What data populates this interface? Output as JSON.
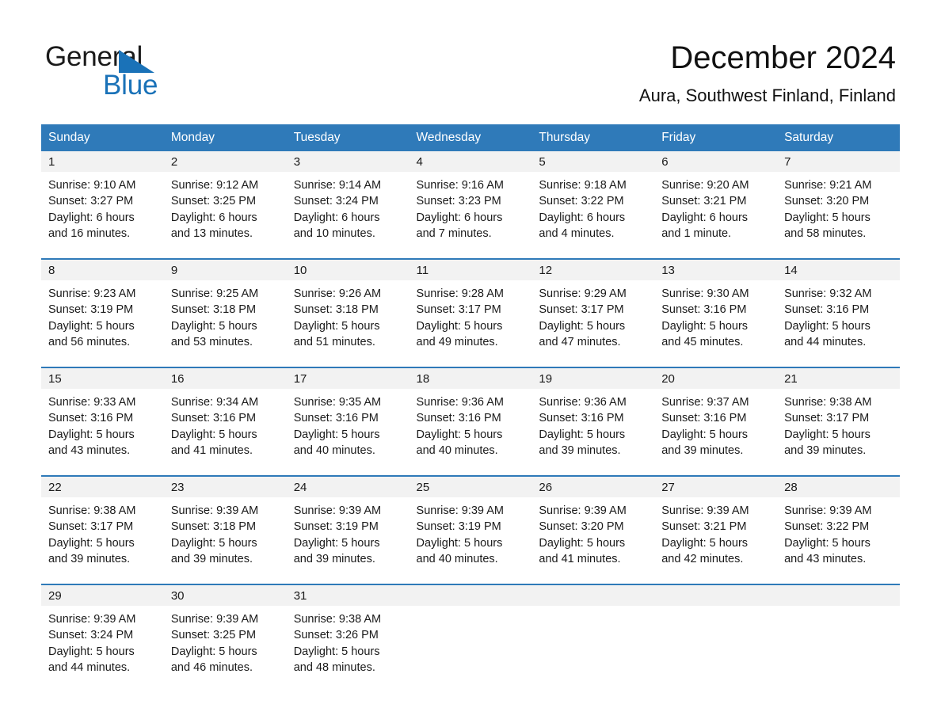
{
  "brand": {
    "name_part1": "General",
    "name_part2": "Blue",
    "triangle_icon": "triangle-icon",
    "accent_color": "#1a72b8"
  },
  "header": {
    "month_title": "December 2024",
    "location": "Aura, Southwest Finland, Finland"
  },
  "theme": {
    "header_row_bg": "#2f7ab9",
    "daynum_band_bg": "#f2f2f2",
    "row_divider": "#2f7ab9",
    "text": "#1a1a1a"
  },
  "weekday_headers": [
    "Sunday",
    "Monday",
    "Tuesday",
    "Wednesday",
    "Thursday",
    "Friday",
    "Saturday"
  ],
  "labels": {
    "sunrise_prefix": "Sunrise:",
    "sunset_prefix": "Sunset:",
    "daylight_prefix": "Daylight:"
  },
  "weeks": [
    {
      "days": [
        {
          "day": "1",
          "sunrise": "Sunrise: 9:10 AM",
          "sunset": "Sunset: 3:27 PM",
          "daylight_line1": "Daylight: 6 hours",
          "daylight_line2": "and 16 minutes."
        },
        {
          "day": "2",
          "sunrise": "Sunrise: 9:12 AM",
          "sunset": "Sunset: 3:25 PM",
          "daylight_line1": "Daylight: 6 hours",
          "daylight_line2": "and 13 minutes."
        },
        {
          "day": "3",
          "sunrise": "Sunrise: 9:14 AM",
          "sunset": "Sunset: 3:24 PM",
          "daylight_line1": "Daylight: 6 hours",
          "daylight_line2": "and 10 minutes."
        },
        {
          "day": "4",
          "sunrise": "Sunrise: 9:16 AM",
          "sunset": "Sunset: 3:23 PM",
          "daylight_line1": "Daylight: 6 hours",
          "daylight_line2": "and 7 minutes."
        },
        {
          "day": "5",
          "sunrise": "Sunrise: 9:18 AM",
          "sunset": "Sunset: 3:22 PM",
          "daylight_line1": "Daylight: 6 hours",
          "daylight_line2": "and 4 minutes."
        },
        {
          "day": "6",
          "sunrise": "Sunrise: 9:20 AM",
          "sunset": "Sunset: 3:21 PM",
          "daylight_line1": "Daylight: 6 hours",
          "daylight_line2": "and 1 minute."
        },
        {
          "day": "7",
          "sunrise": "Sunrise: 9:21 AM",
          "sunset": "Sunset: 3:20 PM",
          "daylight_line1": "Daylight: 5 hours",
          "daylight_line2": "and 58 minutes."
        }
      ]
    },
    {
      "days": [
        {
          "day": "8",
          "sunrise": "Sunrise: 9:23 AM",
          "sunset": "Sunset: 3:19 PM",
          "daylight_line1": "Daylight: 5 hours",
          "daylight_line2": "and 56 minutes."
        },
        {
          "day": "9",
          "sunrise": "Sunrise: 9:25 AM",
          "sunset": "Sunset: 3:18 PM",
          "daylight_line1": "Daylight: 5 hours",
          "daylight_line2": "and 53 minutes."
        },
        {
          "day": "10",
          "sunrise": "Sunrise: 9:26 AM",
          "sunset": "Sunset: 3:18 PM",
          "daylight_line1": "Daylight: 5 hours",
          "daylight_line2": "and 51 minutes."
        },
        {
          "day": "11",
          "sunrise": "Sunrise: 9:28 AM",
          "sunset": "Sunset: 3:17 PM",
          "daylight_line1": "Daylight: 5 hours",
          "daylight_line2": "and 49 minutes."
        },
        {
          "day": "12",
          "sunrise": "Sunrise: 9:29 AM",
          "sunset": "Sunset: 3:17 PM",
          "daylight_line1": "Daylight: 5 hours",
          "daylight_line2": "and 47 minutes."
        },
        {
          "day": "13",
          "sunrise": "Sunrise: 9:30 AM",
          "sunset": "Sunset: 3:16 PM",
          "daylight_line1": "Daylight: 5 hours",
          "daylight_line2": "and 45 minutes."
        },
        {
          "day": "14",
          "sunrise": "Sunrise: 9:32 AM",
          "sunset": "Sunset: 3:16 PM",
          "daylight_line1": "Daylight: 5 hours",
          "daylight_line2": "and 44 minutes."
        }
      ]
    },
    {
      "days": [
        {
          "day": "15",
          "sunrise": "Sunrise: 9:33 AM",
          "sunset": "Sunset: 3:16 PM",
          "daylight_line1": "Daylight: 5 hours",
          "daylight_line2": "and 43 minutes."
        },
        {
          "day": "16",
          "sunrise": "Sunrise: 9:34 AM",
          "sunset": "Sunset: 3:16 PM",
          "daylight_line1": "Daylight: 5 hours",
          "daylight_line2": "and 41 minutes."
        },
        {
          "day": "17",
          "sunrise": "Sunrise: 9:35 AM",
          "sunset": "Sunset: 3:16 PM",
          "daylight_line1": "Daylight: 5 hours",
          "daylight_line2": "and 40 minutes."
        },
        {
          "day": "18",
          "sunrise": "Sunrise: 9:36 AM",
          "sunset": "Sunset: 3:16 PM",
          "daylight_line1": "Daylight: 5 hours",
          "daylight_line2": "and 40 minutes."
        },
        {
          "day": "19",
          "sunrise": "Sunrise: 9:36 AM",
          "sunset": "Sunset: 3:16 PM",
          "daylight_line1": "Daylight: 5 hours",
          "daylight_line2": "and 39 minutes."
        },
        {
          "day": "20",
          "sunrise": "Sunrise: 9:37 AM",
          "sunset": "Sunset: 3:16 PM",
          "daylight_line1": "Daylight: 5 hours",
          "daylight_line2": "and 39 minutes."
        },
        {
          "day": "21",
          "sunrise": "Sunrise: 9:38 AM",
          "sunset": "Sunset: 3:17 PM",
          "daylight_line1": "Daylight: 5 hours",
          "daylight_line2": "and 39 minutes."
        }
      ]
    },
    {
      "days": [
        {
          "day": "22",
          "sunrise": "Sunrise: 9:38 AM",
          "sunset": "Sunset: 3:17 PM",
          "daylight_line1": "Daylight: 5 hours",
          "daylight_line2": "and 39 minutes."
        },
        {
          "day": "23",
          "sunrise": "Sunrise: 9:39 AM",
          "sunset": "Sunset: 3:18 PM",
          "daylight_line1": "Daylight: 5 hours",
          "daylight_line2": "and 39 minutes."
        },
        {
          "day": "24",
          "sunrise": "Sunrise: 9:39 AM",
          "sunset": "Sunset: 3:19 PM",
          "daylight_line1": "Daylight: 5 hours",
          "daylight_line2": "and 39 minutes."
        },
        {
          "day": "25",
          "sunrise": "Sunrise: 9:39 AM",
          "sunset": "Sunset: 3:19 PM",
          "daylight_line1": "Daylight: 5 hours",
          "daylight_line2": "and 40 minutes."
        },
        {
          "day": "26",
          "sunrise": "Sunrise: 9:39 AM",
          "sunset": "Sunset: 3:20 PM",
          "daylight_line1": "Daylight: 5 hours",
          "daylight_line2": "and 41 minutes."
        },
        {
          "day": "27",
          "sunrise": "Sunrise: 9:39 AM",
          "sunset": "Sunset: 3:21 PM",
          "daylight_line1": "Daylight: 5 hours",
          "daylight_line2": "and 42 minutes."
        },
        {
          "day": "28",
          "sunrise": "Sunrise: 9:39 AM",
          "sunset": "Sunset: 3:22 PM",
          "daylight_line1": "Daylight: 5 hours",
          "daylight_line2": "and 43 minutes."
        }
      ]
    },
    {
      "days": [
        {
          "day": "29",
          "sunrise": "Sunrise: 9:39 AM",
          "sunset": "Sunset: 3:24 PM",
          "daylight_line1": "Daylight: 5 hours",
          "daylight_line2": "and 44 minutes."
        },
        {
          "day": "30",
          "sunrise": "Sunrise: 9:39 AM",
          "sunset": "Sunset: 3:25 PM",
          "daylight_line1": "Daylight: 5 hours",
          "daylight_line2": "and 46 minutes."
        },
        {
          "day": "31",
          "sunrise": "Sunrise: 9:38 AM",
          "sunset": "Sunset: 3:26 PM",
          "daylight_line1": "Daylight: 5 hours",
          "daylight_line2": "and 48 minutes."
        },
        {
          "day": "",
          "sunrise": "",
          "sunset": "",
          "daylight_line1": "",
          "daylight_line2": ""
        },
        {
          "day": "",
          "sunrise": "",
          "sunset": "",
          "daylight_line1": "",
          "daylight_line2": ""
        },
        {
          "day": "",
          "sunrise": "",
          "sunset": "",
          "daylight_line1": "",
          "daylight_line2": ""
        },
        {
          "day": "",
          "sunrise": "",
          "sunset": "",
          "daylight_line1": "",
          "daylight_line2": ""
        }
      ]
    }
  ]
}
